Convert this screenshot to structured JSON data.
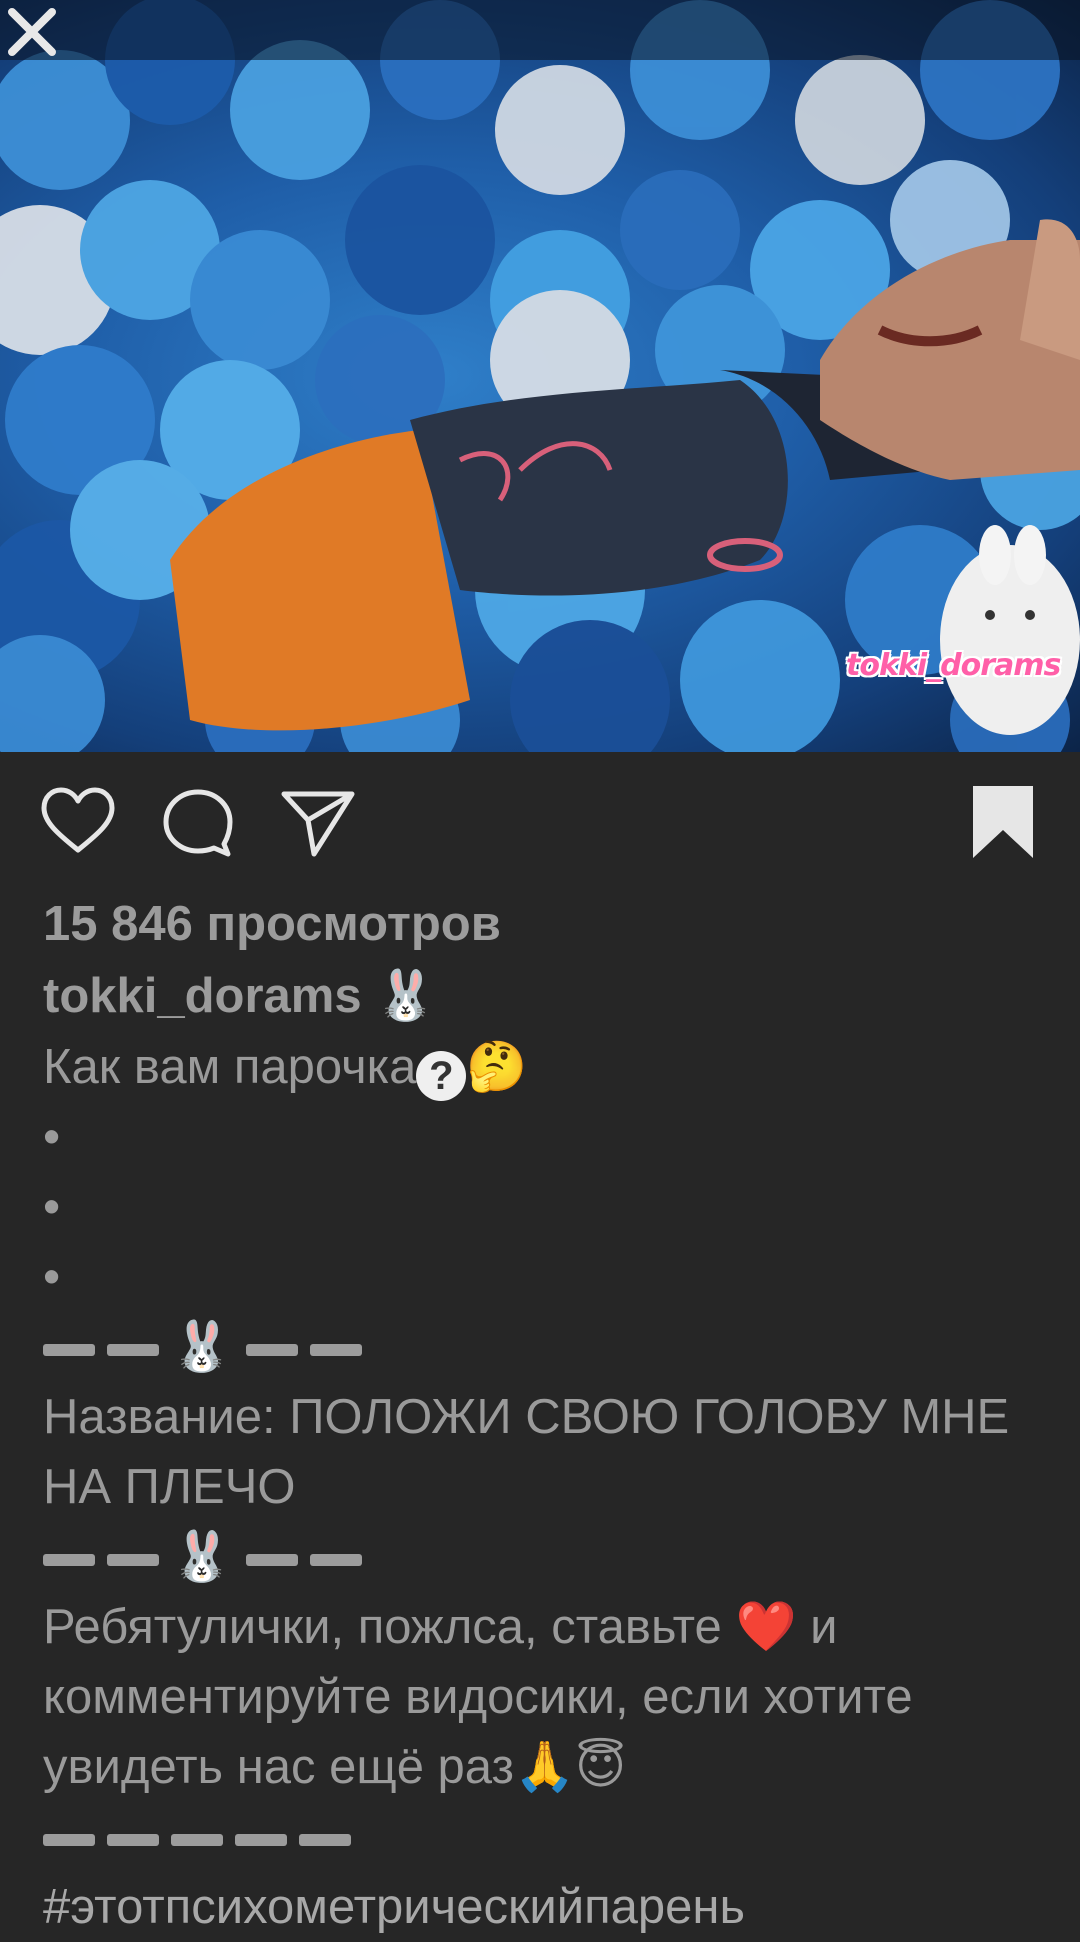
{
  "media": {
    "watermark": "tokki_dorams",
    "close_icon": "close-icon"
  },
  "actions": {
    "like_icon": "heart-icon",
    "comment_icon": "comment-bubble-icon",
    "share_icon": "paper-plane-icon",
    "save_icon": "bookmark-icon"
  },
  "post": {
    "views": "15 846 просмотров",
    "author": "tokki_dorams",
    "author_emoji": "🐰",
    "caption_line1": "Как вам парочка",
    "caption_line1_emoji": "🤔",
    "question_mark": "?",
    "dot": "•",
    "divider_emoji": "🐰",
    "title_line": "Название: ПОЛОЖИ СВОЮ ГОЛОВУ МНЕ НА ПЛЕЧО",
    "request_text": "Ребятулички, пожлса, ставьте",
    "heart_emoji": "❤️",
    "request_text2": "и комментируйте видосики, если хотите увидеть нас ещё раз",
    "request_emoji": "🙏😇",
    "hashtag": "#этотпсихометрическийпарень"
  },
  "colors": {
    "background": "#262626",
    "text": "#9a9a9a",
    "watermark": "#ff5fa8"
  }
}
